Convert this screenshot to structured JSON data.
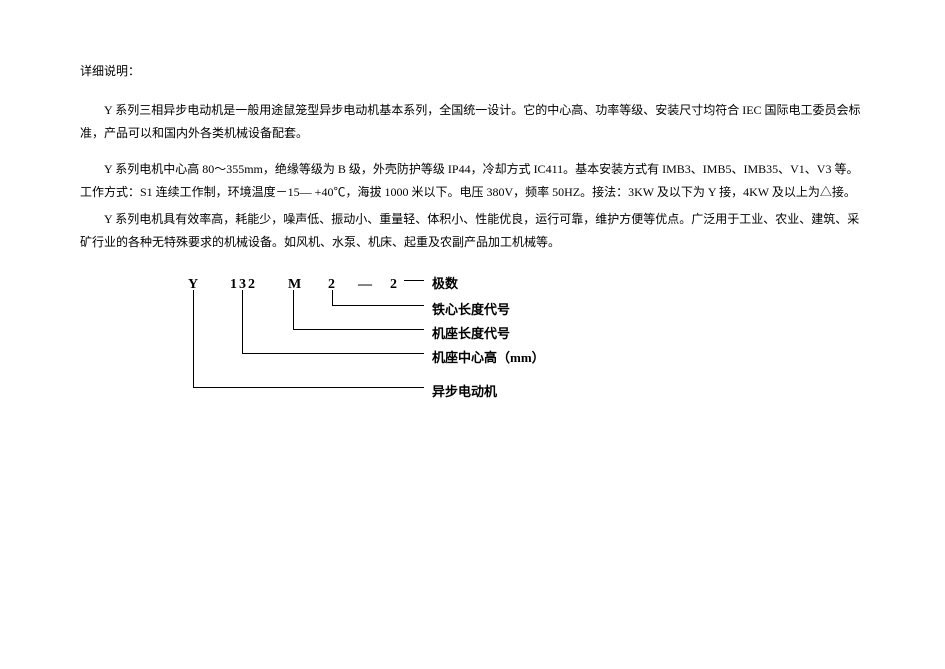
{
  "heading": "详细说明：",
  "para1": "Y 系列三相异步电动机是一般用途鼠笼型异步电动机基本系列，全国统一设计。它的中心高、功率等级、安装尺寸均符合 IEC 国际电工委员会标准，产品可以和国内外各类机械设备配套。",
  "para2": "Y 系列电机中心高 80～355mm，绝缘等级为 B 级，外壳防护等级 IP44，冷却方式 IC411。基本安装方式有 IMB3、IMB5、IMB35、V1、V3 等。工作方式：S1 连续工作制，环境温度－15— +40℃，海拔 1000 米以下。电压 380V，频率 50HZ。接法：3KW 及以下为 Y 接，4KW 及以上为△接。",
  "para3": "Y 系列电机具有效率高，耗能少，噪声低、振动小、重量轻、体积小、性能优良，运行可靠，维护方便等优点。广泛用于工业、农业、建筑、采矿行业的各种无特殊要求的机械设备。如风机、水泵、机床、起重及农副产品加工机械等。",
  "code": {
    "seg1": "Y",
    "seg2": "132",
    "seg3": "M",
    "seg4": "2",
    "dash": "—",
    "seg5": "2"
  },
  "labels": {
    "l1": "极数",
    "l2": "铁心长度代号",
    "l3": "机座长度代号",
    "l4": "机座中心高（mm）",
    "l5": "异步电动机"
  }
}
